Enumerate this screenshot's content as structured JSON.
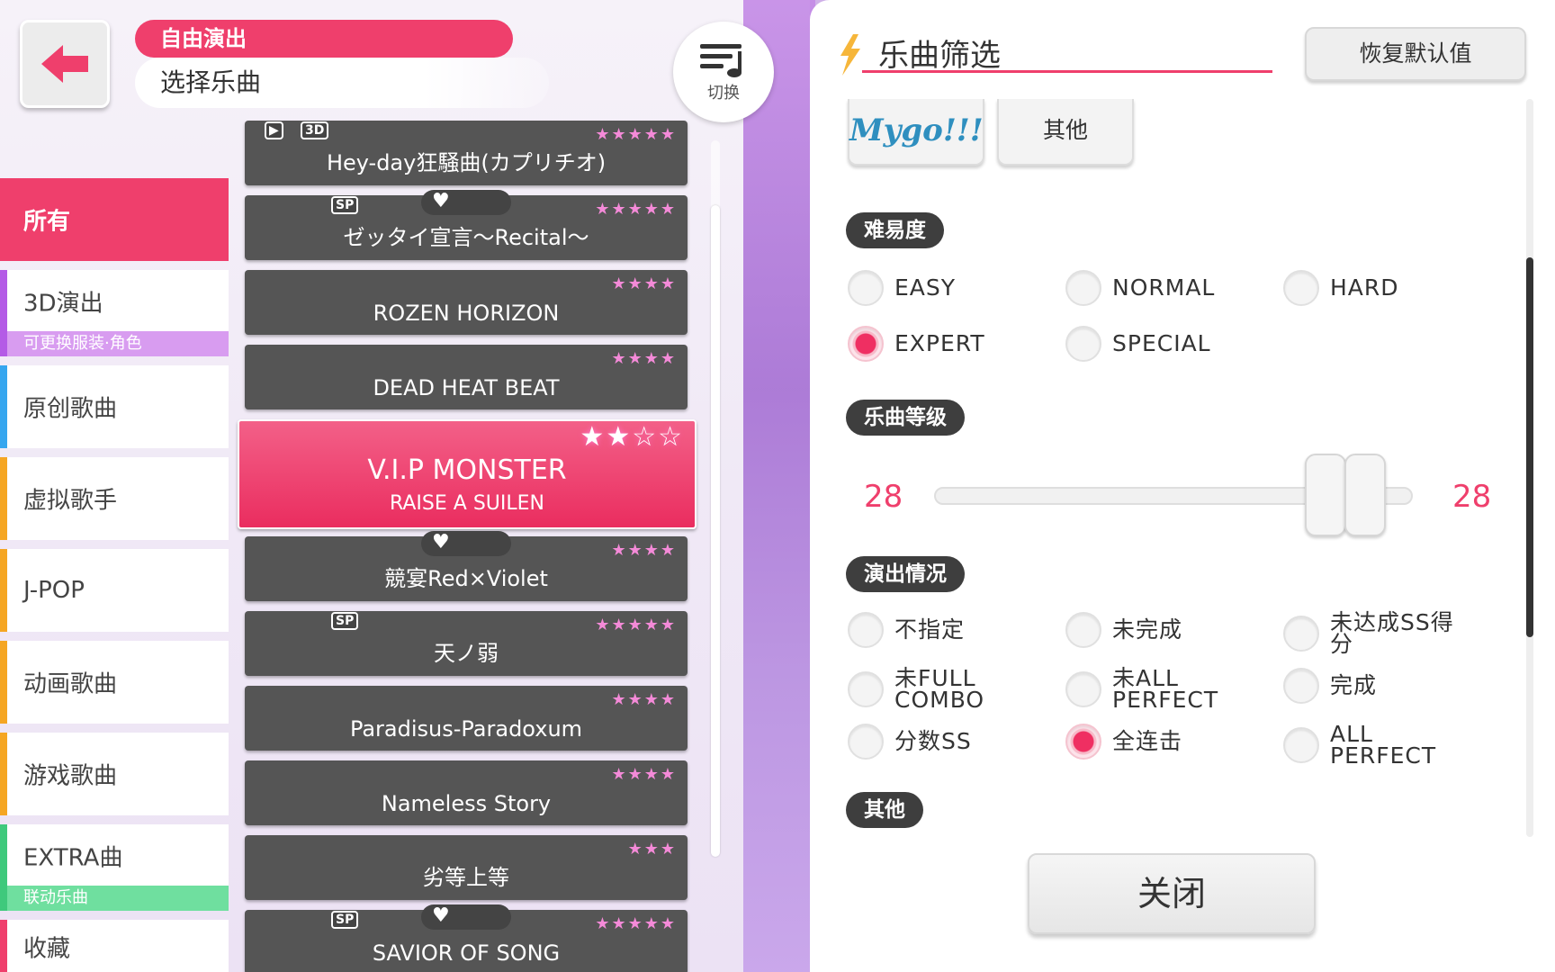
{
  "header": {
    "mode_label": "自由演出",
    "title": "选择乐曲",
    "switch_label": "切换"
  },
  "categories": [
    {
      "label": "所有",
      "bar_color": "#ef3f6c"
    },
    {
      "label": "3D演出",
      "sub": "可更换服装·角色",
      "bar_color": "#b45be6",
      "sub_color": "#d89cf0"
    },
    {
      "label": "原创歌曲",
      "bar_color": "#36a6ef"
    },
    {
      "label": "虚拟歌手",
      "bar_color": "#f5a623"
    },
    {
      "label": "J-POP",
      "bar_color": "#f5a623"
    },
    {
      "label": "动画歌曲",
      "bar_color": "#f5a623"
    },
    {
      "label": "游戏歌曲",
      "bar_color": "#f5a623"
    },
    {
      "label": "EXTRA曲",
      "sub": "联动乐曲",
      "bar_color": "#3fc97c",
      "sub_color": "#6fdf9f"
    },
    {
      "label": "收藏",
      "bar_color": "#ef3f6c"
    }
  ],
  "songs": [
    {
      "title": "Hey-day狂騒曲(カプリチオ)",
      "stars": "★★★★★",
      "tags": [
        "▶",
        "3D"
      ]
    },
    {
      "title": "ゼッタイ宣言～Recital～",
      "stars": "★★★★★",
      "tags": [
        "SP"
      ],
      "heart": "♥"
    },
    {
      "title": "ROZEN HORIZON",
      "stars": "★★★★"
    },
    {
      "title": "DEAD HEAT BEAT",
      "stars": "★★★★"
    },
    {
      "title": "V.I.P MONSTER",
      "band": "RAISE A SUILEN",
      "stars": "★★☆☆",
      "selected": true
    },
    {
      "title": "競宴Red×Violet",
      "stars": "★★★★",
      "heart": "♥"
    },
    {
      "title": "天ノ弱",
      "stars": "★★★★★",
      "tags": [
        "SP"
      ]
    },
    {
      "title": "Paradisus-Paradoxum",
      "stars": "★★★★"
    },
    {
      "title": "Nameless Story",
      "stars": "★★★★"
    },
    {
      "title": "劣等上等",
      "stars": "★★★"
    },
    {
      "title": "SAVIOR OF SONG",
      "stars": "★★★★★",
      "tags": [
        "SP"
      ],
      "heart": "♥"
    }
  ],
  "filter_panel": {
    "title": "乐曲筛选",
    "reset_label": "恢复默认值",
    "other_tile_label": "其他",
    "logo_text": "Mygo!!!",
    "difficulty": {
      "label": "难易度",
      "options": [
        {
          "label": "EASY",
          "selected": false
        },
        {
          "label": "NORMAL",
          "selected": false
        },
        {
          "label": "HARD",
          "selected": false
        },
        {
          "label": "EXPERT",
          "selected": true
        },
        {
          "label": "SPECIAL",
          "selected": false
        }
      ]
    },
    "level": {
      "label": "乐曲等级",
      "min": "28",
      "max": "28"
    },
    "status": {
      "label": "演出情况",
      "options": [
        {
          "label": "不指定",
          "selected": false
        },
        {
          "label": "未完成",
          "selected": false
        },
        {
          "label": "未达成SS得分",
          "selected": false
        },
        {
          "label": "未FULL COMBO",
          "selected": false
        },
        {
          "label": "未ALL PERFECT",
          "selected": false
        },
        {
          "label": "完成",
          "selected": false
        },
        {
          "label": "分数SS",
          "selected": false
        },
        {
          "label": "全连击",
          "selected": true
        },
        {
          "label": "ALL PERFECT",
          "selected": false
        }
      ]
    },
    "other_label": "其他",
    "close_label": "关闭"
  },
  "colors": {
    "accent": "#ef3f6c",
    "song_bg": "#555555",
    "pill_bg": "#3e3e3e"
  }
}
